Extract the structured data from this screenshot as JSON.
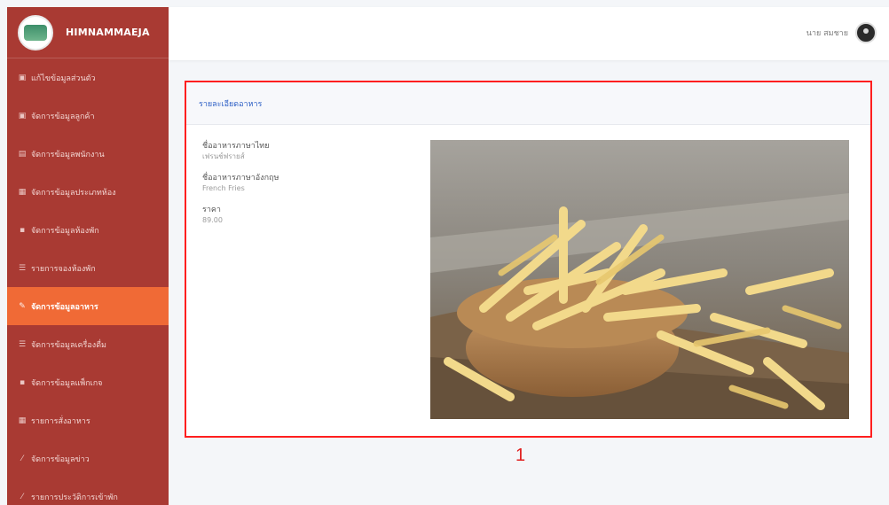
{
  "brand": {
    "name": "HIMNAMMAEJA"
  },
  "sidebar": {
    "items": [
      {
        "icon": "user-icon",
        "label": "แก้ไขข้อมูลส่วนตัว",
        "active": false
      },
      {
        "icon": "users-icon",
        "label": "จัดการข้อมูลลูกค้า",
        "active": false
      },
      {
        "icon": "users-icon",
        "label": "จัดการข้อมูลพนักงาน",
        "active": false
      },
      {
        "icon": "grid-icon",
        "label": "จัดการข้อมูลประเภทห้อง",
        "active": false
      },
      {
        "icon": "bed-icon",
        "label": "จัดการข้อมูลห้องพัก",
        "active": false
      },
      {
        "icon": "list-icon",
        "label": "รายการจองห้องพัก",
        "active": false
      },
      {
        "icon": "food-icon",
        "label": "จัดการข้อมูลอาหาร",
        "active": true
      },
      {
        "icon": "list-icon",
        "label": "จัดการข้อมูลเครื่องดื่ม",
        "active": false
      },
      {
        "icon": "bed-icon",
        "label": "จัดการข้อมูลแพ็กเกจ",
        "active": false
      },
      {
        "icon": "grid-icon",
        "label": "รายการสั่งอาหาร",
        "active": false
      },
      {
        "icon": "pencil-icon",
        "label": "จัดการข้อมูลข่าว",
        "active": false
      },
      {
        "icon": "pencil-icon",
        "label": "รายการประวัติการเข้าพัก",
        "active": false
      }
    ]
  },
  "topbar": {
    "user_name": "นาย สมชาย"
  },
  "card": {
    "title": "รายละเอียดอาหาร",
    "fields": [
      {
        "label": "ชื่ออาหารภาษาไทย",
        "value": "เฟรนช์ฟรายส์"
      },
      {
        "label": "ชื่ออาหารภาษาอังกฤษ",
        "value": "French Fries"
      },
      {
        "label": "ราคา",
        "value": "89.00"
      }
    ]
  },
  "annotation": {
    "label": "1"
  },
  "colors": {
    "sidebar": "#a93a33",
    "active": "#f06a36",
    "highlight_border": "#ff1f1f",
    "title_blue": "#2c5ec5"
  }
}
